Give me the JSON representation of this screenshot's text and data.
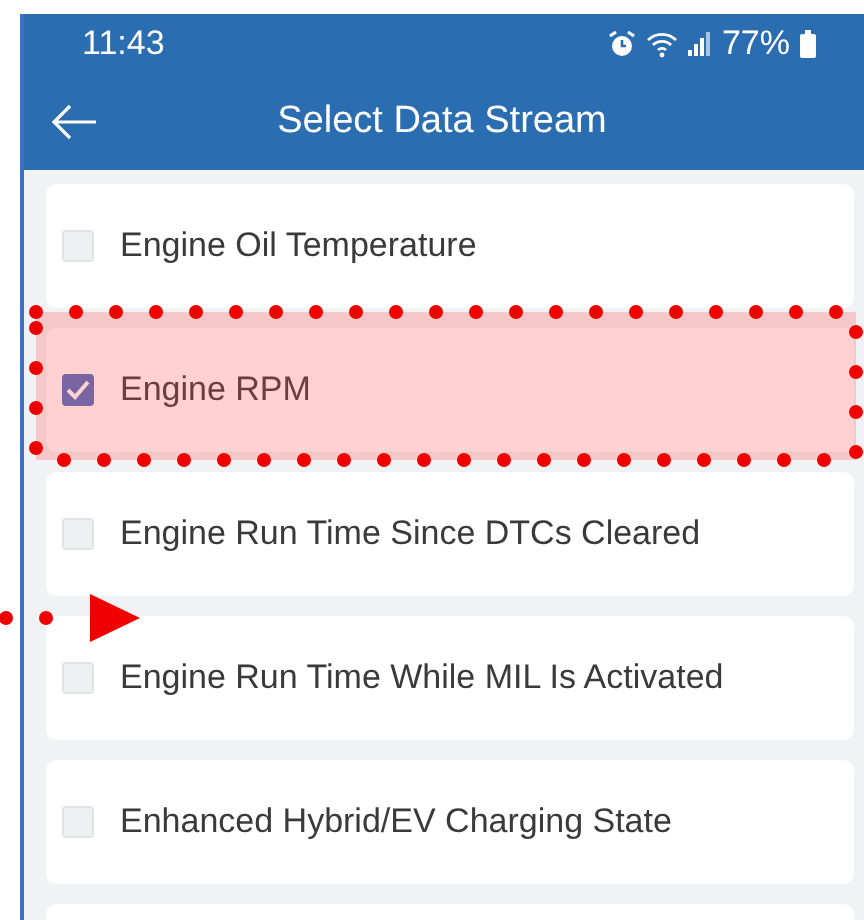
{
  "status_bar": {
    "time": "11:43",
    "battery": "77%"
  },
  "header": {
    "title": "Select Data Stream"
  },
  "items": [
    {
      "label": "Engine Oil Temperature",
      "checked": false
    },
    {
      "label": "Engine RPM",
      "checked": true
    },
    {
      "label": "Engine Run Time Since DTCs Cleared",
      "checked": false
    },
    {
      "label": "Engine Run Time While MIL Is Activated",
      "checked": false
    },
    {
      "label": "Enhanced Hybrid/EV Charging State",
      "checked": false
    }
  ]
}
